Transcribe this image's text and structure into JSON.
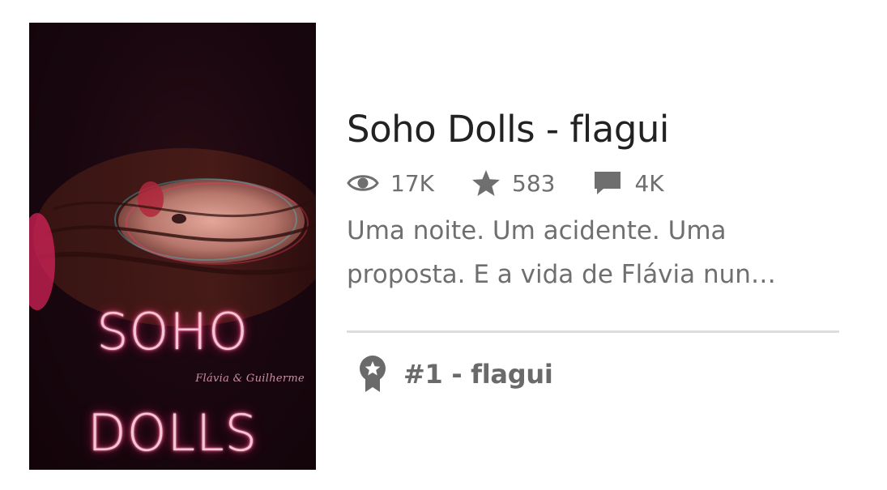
{
  "story": {
    "title": "Soho Dolls - flagui",
    "description_line1": "Uma noite. Um acidente. Uma",
    "description_line2": "proposta. E a vida de Flávia nun…"
  },
  "cover": {
    "title_line1": "SOHO",
    "title_line2": "DOLLS",
    "authors": "Flávia & Guilherme"
  },
  "stats": {
    "reads": {
      "icon": "eye-icon",
      "value": "17K"
    },
    "votes": {
      "icon": "star-icon",
      "value": "583"
    },
    "comments": {
      "icon": "comment-icon",
      "value": "4K"
    }
  },
  "ranking": {
    "icon": "award-badge-icon",
    "label": "#1 - flagui"
  },
  "colors": {
    "text_primary": "#222222",
    "text_secondary": "#6f6f6f",
    "divider": "#dddddd",
    "neon_pink": "#ff4d88"
  }
}
